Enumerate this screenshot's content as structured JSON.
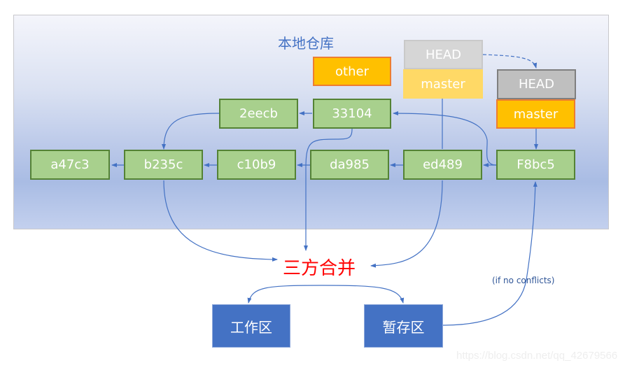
{
  "repo": {
    "title": "本地仓库",
    "commits": {
      "a47c3": "a47c3",
      "b235c": "b235c",
      "c10b9": "c10b9",
      "da985": "da985",
      "ed489": "ed489",
      "f8bc5": "F8bc5",
      "2eecb": "2eecb",
      "33104": "33104"
    },
    "refs": {
      "other": "other",
      "old_head": "HEAD",
      "old_master": "master",
      "new_head": "HEAD",
      "new_master": "master"
    }
  },
  "merge": {
    "title": "三方合并",
    "note": "(if no conflicts)"
  },
  "areas": {
    "working": "工作区",
    "staging": "暂存区"
  },
  "watermark": "https://blog.csdn.net/qq_42679566",
  "colors": {
    "commit_fill": "#a8d08d",
    "commit_border": "#548235",
    "ref_fill": "#ffc000",
    "area_fill": "#4472c4",
    "arrow": "#4472c4",
    "merge_text": "#ff0000"
  }
}
